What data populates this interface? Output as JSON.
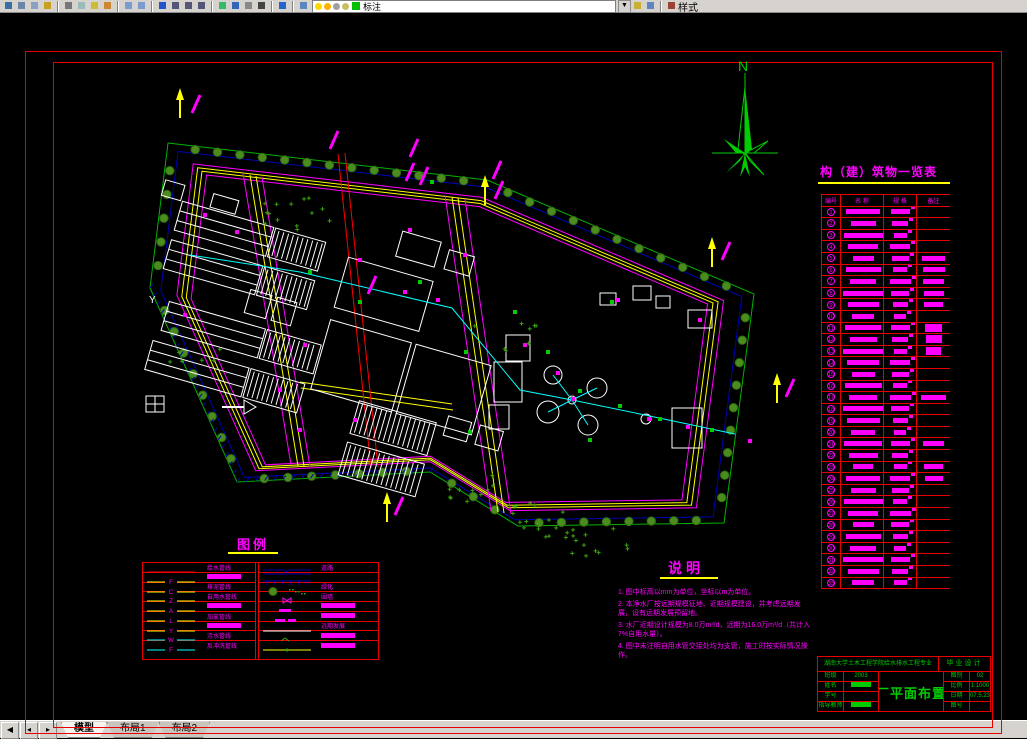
{
  "toolbar": {
    "layer_combo_value": "标注",
    "styles_label": "样式",
    "icon_names": [
      "save",
      "plot",
      "print-preview",
      "find",
      "cut",
      "copy",
      "paste",
      "match-properties",
      "undo",
      "redo",
      "pan",
      "zoom-realtime",
      "zoom-window",
      "zoom-previous",
      "distance",
      "area",
      "osnap",
      "grid",
      "calculator",
      "help",
      "layers-dialog",
      "make-layer-current",
      "layer-previous",
      "text-style"
    ]
  },
  "tabs": {
    "items": [
      "模型",
      "布局1",
      "布局2"
    ],
    "active_index": 0
  },
  "plan": {
    "north_label": "N"
  },
  "legend": {
    "title": "图例",
    "left_rows": [
      {
        "letter": "",
        "color": "#ff0000",
        "label": "给水管线",
        "block": false
      },
      {
        "letter": "F",
        "color": "#ffff00",
        "label": "",
        "block": true
      },
      {
        "letter": "C",
        "color": "#ffff00",
        "label": "排泥管线",
        "block": false
      },
      {
        "letter": "Z",
        "color": "#ffff00",
        "label": "自用水管线",
        "block": false
      },
      {
        "letter": "A",
        "color": "#ffff00",
        "label": "",
        "block": true
      },
      {
        "letter": "L",
        "color": "#ffff00",
        "label": "加氯管线",
        "block": false
      },
      {
        "letter": "Y",
        "color": "#ffff00",
        "label": "",
        "block": true
      },
      {
        "letter": "W",
        "color": "#00ffff",
        "label": "污水管线",
        "block": false
      },
      {
        "letter": "F",
        "color": "#00ffff",
        "label": "反冲洗管线",
        "block": false
      }
    ],
    "right_rows": [
      {
        "symbol": "road",
        "label": "道路",
        "block": false
      },
      {
        "symbol": "ticked-line",
        "label": "",
        "block": false
      },
      {
        "symbol": "trees",
        "label": "绿化",
        "block": false
      },
      {
        "symbol": "fence",
        "label": "围墙",
        "block": false
      },
      {
        "symbol": "dash",
        "label": "",
        "block": true
      },
      {
        "symbol": "dash-wide",
        "label": "",
        "block": true
      },
      {
        "symbol": "white-line",
        "label": "远期发展",
        "block": false
      },
      {
        "symbol": "green-mark",
        "label": "",
        "block": true
      },
      {
        "symbol": "survey-line",
        "label": "",
        "block": true
      }
    ]
  },
  "notes": {
    "title": "说明",
    "items": [
      "1. 图中标高以mm为单位，坐标以m为单位。",
      "2. 本净水厂按远期规模征地、近期规模建设，并考虑远期发展，设有远期发展预留地。",
      "3. 水厂近期设计规模为8.0万m³/d，远期为16.0万m³/d（共计入7%自用水量）。",
      "4. 图中未注明自用水管交接处均为支管，施工时按实际情况操作。"
    ]
  },
  "building_table": {
    "title": "构（建）筑物一览表",
    "headers": [
      "编号",
      "名 称",
      "规 格",
      "备注"
    ],
    "row_count": 33,
    "remark_rows": [
      5,
      6,
      7,
      8,
      9,
      11,
      12,
      13,
      17,
      21,
      23,
      24
    ],
    "tall_remark_rows": [
      11,
      12,
      13
    ]
  },
  "title_block": {
    "school": "湖南大学土木工程学院给水排水工程专业",
    "project_type": "毕业设计",
    "title": "水厂平面布置图",
    "left_rows": [
      {
        "label": "班级",
        "value": "2003",
        "block": false
      },
      {
        "label": "姓名",
        "value": "",
        "block": true
      },
      {
        "label": "学号",
        "value": "",
        "block": false
      },
      {
        "label": "指导教师",
        "value": "",
        "block": true
      }
    ],
    "right_rows": [
      {
        "label": "图别",
        "value": "02",
        "block": false
      },
      {
        "label": "比例",
        "value": "1:1000",
        "block": false
      },
      {
        "label": "日期",
        "value": "07.5.23",
        "block": false
      },
      {
        "label": "图号",
        "value": "",
        "block": false
      }
    ]
  },
  "colors": {
    "frame": "#e80000",
    "annotation": "#ff00ff",
    "road": "#ffff00",
    "boundary": "#00b400",
    "tree": "#4c8c1e",
    "pipe_cyan": "#00ffff",
    "pipe_blue": "#0000b3",
    "text_green": "#00cc00",
    "underline": "#ffff00"
  }
}
